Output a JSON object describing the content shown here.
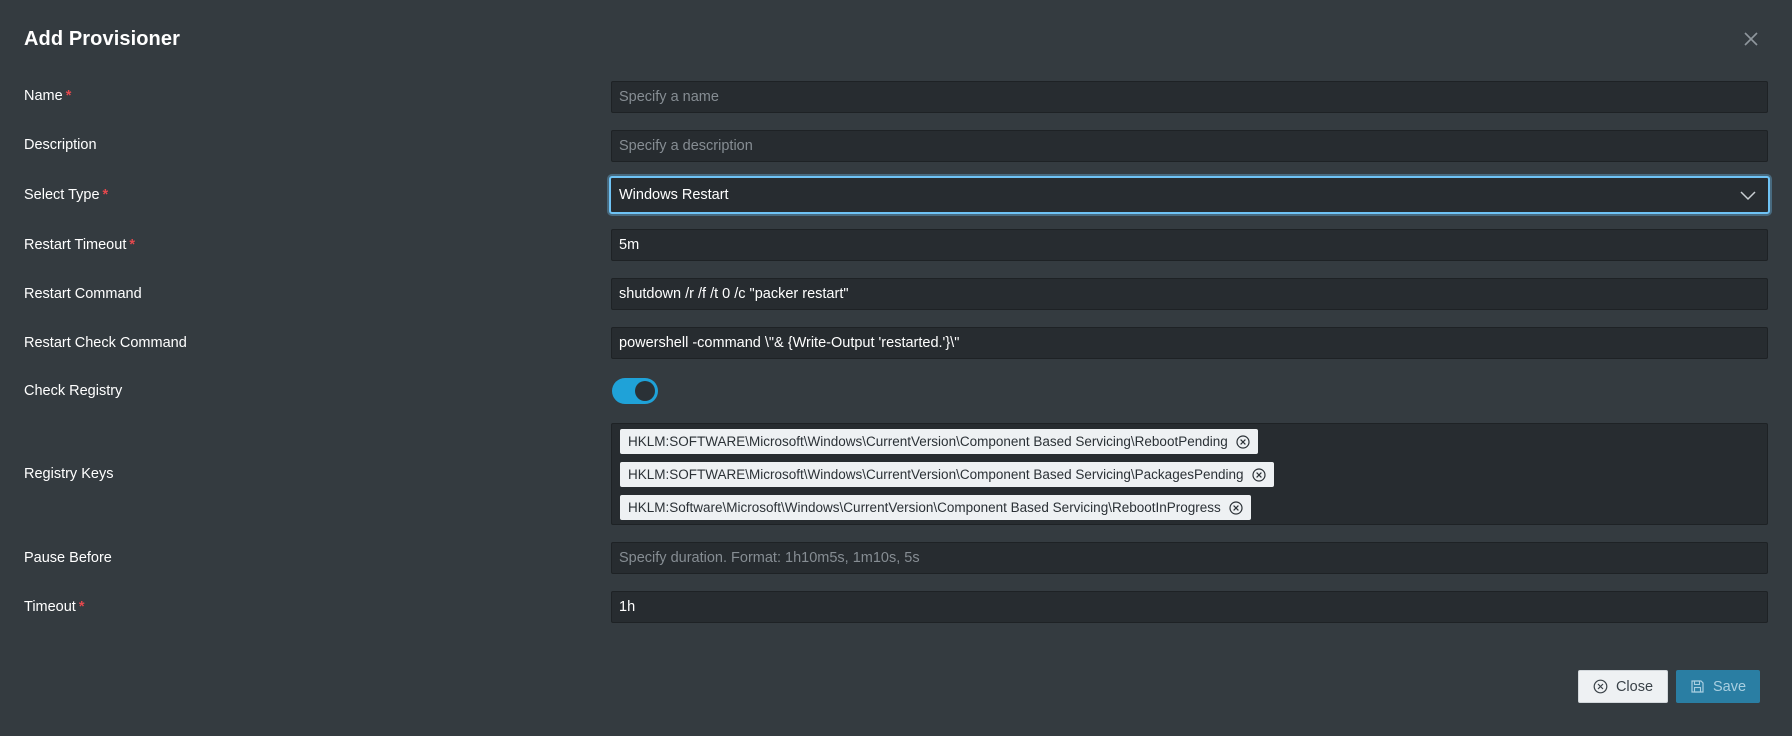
{
  "dialog": {
    "title": "Add Provisioner"
  },
  "fields": {
    "name": {
      "label": "Name",
      "required_mark": "*",
      "value": "",
      "placeholder": "Specify a name"
    },
    "description": {
      "label": "Description",
      "value": "",
      "placeholder": "Specify a description"
    },
    "type": {
      "label": "Select Type",
      "required_mark": "*",
      "value": "Windows Restart"
    },
    "restart_timeout": {
      "label": "Restart Timeout",
      "required_mark": "*",
      "value": "5m"
    },
    "restart_command": {
      "label": "Restart Command",
      "value": "shutdown /r /f /t 0 /c \"packer restart\""
    },
    "restart_check_command": {
      "label": "Restart Check Command",
      "value": "powershell -command \\\"& {Write-Output 'restarted.'}\\\""
    },
    "check_registry": {
      "label": "Check Registry",
      "value": true
    },
    "registry_keys": {
      "label": "Registry Keys",
      "items": [
        "HKLM:SOFTWARE\\Microsoft\\Windows\\CurrentVersion\\Component Based Servicing\\RebootPending",
        "HKLM:SOFTWARE\\Microsoft\\Windows\\CurrentVersion\\Component Based Servicing\\PackagesPending",
        "HKLM:Software\\Microsoft\\Windows\\CurrentVersion\\Component Based Servicing\\RebootInProgress"
      ]
    },
    "pause_before": {
      "label": "Pause Before",
      "value": "",
      "placeholder": "Specify duration. Format: 1h10m5s, 1m10s, 5s"
    },
    "timeout": {
      "label": "Timeout",
      "required_mark": "*",
      "value": "1h"
    }
  },
  "footer": {
    "close_label": "Close",
    "save_label": "Save"
  },
  "icons": {
    "close": "close-icon",
    "chevron": "chevron-down-icon",
    "tag_remove": "circle-x-icon",
    "save": "floppy-disk-icon"
  },
  "colors": {
    "background": "#343b40",
    "input_bg": "#272c30",
    "accent": "#1fa2d8",
    "required": "#e5484d",
    "focus": "#6fc3f5",
    "save_button": "#2a7ea3"
  }
}
